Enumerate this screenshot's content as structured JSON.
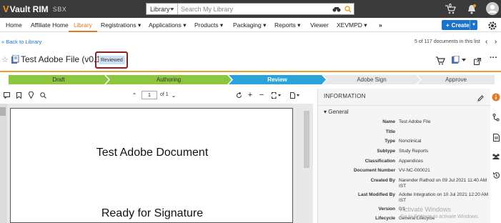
{
  "app": {
    "logo_mark": "V",
    "logo_text": "Vault RIM",
    "env": "SBX",
    "search_scope": "Library",
    "search_placeholder": "Search My Library",
    "cart_count": "0",
    "icons": [
      "binoculars-icon",
      "search-icon",
      "cart-icon",
      "bell-icon",
      "user-avatar"
    ]
  },
  "nav": {
    "items": [
      "Home",
      "Affiliate Home",
      "Library",
      "Registrations",
      "Applications",
      "Products",
      "Packaging",
      "Reports",
      "Viewer",
      "XEVMPD"
    ],
    "active": "Library",
    "create_label": "Create",
    "more_glyph": "»"
  },
  "back": {
    "link": "« Back to Library",
    "count": "5 of 117 documents in this list"
  },
  "document": {
    "title": "Test Adobe File (v0.1)",
    "status": "Reviewed"
  },
  "lifecycle": {
    "stages": [
      "Draft",
      "Authoring",
      "Review",
      "Adobe Sign",
      "Approve"
    ],
    "current": "Review"
  },
  "viewer": {
    "page": "1",
    "of": "of 1",
    "heading": "Test Adobe Document",
    "subheading": "Ready for Signature"
  },
  "info": {
    "title": "INFORMATION",
    "section": "General",
    "fields": [
      {
        "label": "Name",
        "value": "Test Adobe File"
      },
      {
        "label": "Title",
        "value": ""
      },
      {
        "label": "Type",
        "value": "Nonclinical"
      },
      {
        "label": "Subtype",
        "value": "Study Reports"
      },
      {
        "label": "Classification",
        "value": "Appendices"
      },
      {
        "label": "Document Number",
        "value": "VV-NC-000021"
      },
      {
        "label": "Created By",
        "value": "Narender Rathod on 09 Jul 2021 11:40 AM IST"
      },
      {
        "label": "Last Modified By",
        "value": "Adobe Integration on 10 Jul 2021 12:20 AM IST"
      },
      {
        "label": "Version",
        "value": "0.1"
      },
      {
        "label": "Lifecycle",
        "value": "General Lifecycle"
      }
    ]
  },
  "watermark": {
    "line1": "Activate Windows",
    "line2": "Go to Settings to activate Windows."
  },
  "colors": {
    "topbar": "#3a3a3a",
    "accent_orange": "#f39a2d",
    "stage_done": "#8cc63f",
    "stage_current": "#29a3d8",
    "stage_pending": "#e8e8e8",
    "create_button": "#1a73c9",
    "status_highlight": "#8b2020"
  }
}
